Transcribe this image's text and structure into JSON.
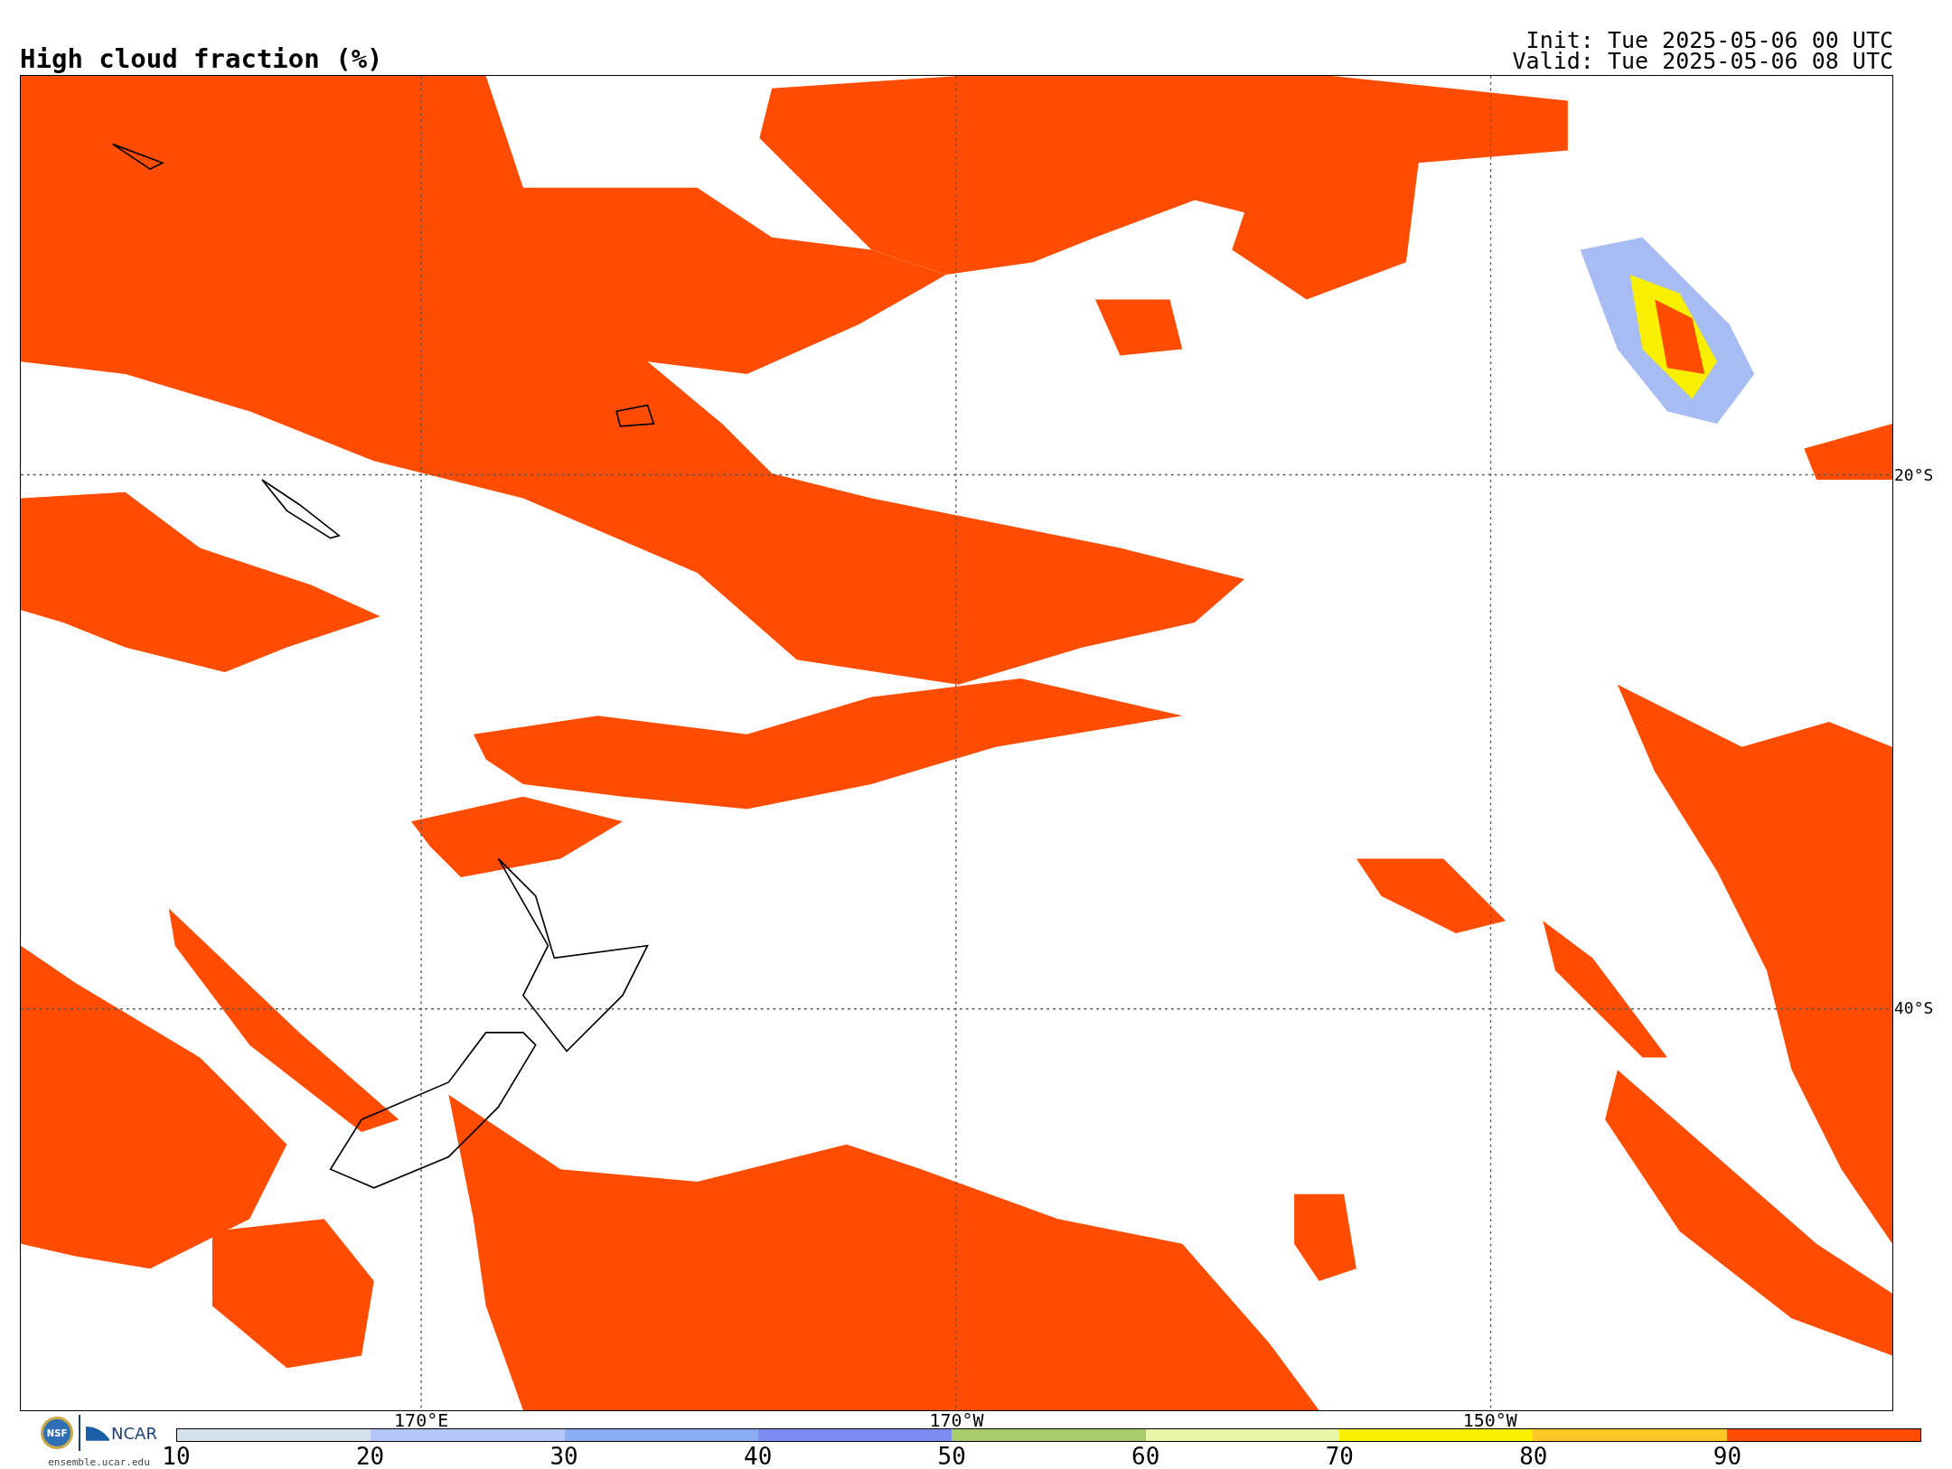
{
  "title": "High cloud fraction (%)",
  "init": "Init: Tue 2025-05-06 00 UTC",
  "valid": "Valid: Tue 2025-05-06 08 UTC",
  "map": {
    "lon_labels": [
      "170°E",
      "170°W",
      "150°W"
    ],
    "lat_labels": [
      "20°S",
      "40°S"
    ]
  },
  "logos": {
    "nsf": "NSF",
    "ncar": "NCAR",
    "url": "ensemble.ucar.edu"
  },
  "colorbar": {
    "segments": [
      {
        "color": "#d4e0ea",
        "tick": "10"
      },
      {
        "color": "#b4c8f8",
        "tick": "20"
      },
      {
        "color": "#8cacf6",
        "tick": "30"
      },
      {
        "color": "#7c8cf0",
        "tick": "40"
      },
      {
        "color": "#a8cc6c",
        "tick": "50"
      },
      {
        "color": "#e8f4a8",
        "tick": "60"
      },
      {
        "color": "#f8f000",
        "tick": "70"
      },
      {
        "color": "#ffc828",
        "tick": "80"
      },
      {
        "color": "#ff4c00",
        "tick": "90"
      }
    ]
  }
}
